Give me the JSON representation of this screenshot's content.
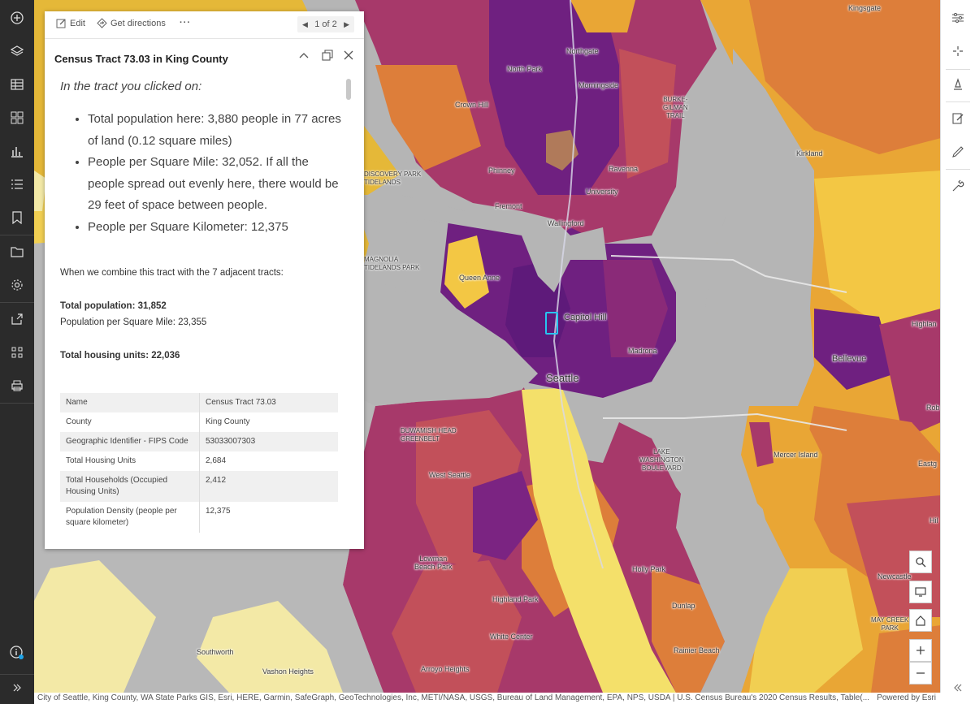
{
  "left_toolbar": {
    "items": [
      "add-icon",
      "layers-icon",
      "table-icon",
      "legend-icon",
      "charts-icon",
      "properties-icon",
      "bookmark-icon",
      "folder-icon",
      "settings-icon",
      "share-icon",
      "apps-icon",
      "print-icon"
    ],
    "bottom": [
      "info-icon",
      "expand-icon"
    ]
  },
  "right_toolbar": {
    "items": [
      "filter-icon",
      "effects-icon",
      "styles-icon",
      "edit-icon",
      "sketch-icon",
      "config-icon"
    ],
    "collapse": "collapse-icon"
  },
  "popup": {
    "edit_label": "Edit",
    "directions_label": "Get directions",
    "more_label": "···",
    "pager_label": "1 of 2",
    "title": "Census Tract 73.03 in King County",
    "intro": "In the tract you clicked on:",
    "bullets": [
      "Total population here: 3,880 people in 77 acres of land (0.12 square miles)",
      "People per Square Mile: 32,052. If all the people spread out evenly here, there would be 29 feet of space between people.",
      "People per Square Kilometer: 12,375"
    ],
    "combine_text": "When we combine this tract with the 7 adjacent tracts:",
    "total_population_label": "Total population: 31,852",
    "pop_per_sqmi": "Population per Square Mile: 23,355",
    "total_housing_label": "Total housing units: 22,036",
    "fields": [
      {
        "k": "Name",
        "v": "Census Tract 73.03"
      },
      {
        "k": "County",
        "v": "King County"
      },
      {
        "k": "Geographic Identifier - FIPS Code",
        "v": "53033007303"
      },
      {
        "k": "Total Housing Units",
        "v": "2,684"
      },
      {
        "k": "Total Households (Occupied Housing Units)",
        "v": "2,412"
      },
      {
        "k": "Population Density (people per square kilometer)",
        "v": "12,375"
      }
    ]
  },
  "map": {
    "labels": {
      "kingsgate": "Kingsgate",
      "northgate": "Northgate",
      "north_park": "North Park",
      "morningside": "Morningside",
      "burke_gilman": "BURKE-\nGILMAN\nTRAIL",
      "crown_hill": "Crown Hill",
      "kirkland": "Kirkland",
      "discovery": "DISCOVERY PARK\nTIDELANDS",
      "phinney": "Phinney",
      "ravenna": "Ravenna",
      "university": "University",
      "fremont": "Fremont",
      "wallingford": "Wallingford",
      "magnolia": "MAGNOLIA\nTIDELANDS PARK",
      "queen_anne": "Queen Anne",
      "capitol_hill": "Capitol Hill",
      "highlan": "Highlan",
      "madrona": "Madrona",
      "bellevue": "Bellevue",
      "seattle": "Seattle",
      "rob": "Rob",
      "duwamish": "DUWAMISH HEAD\nGREENBELT",
      "lake_wa_blvd": "LAKE\nWASHINGTON\nBOULEVARD",
      "mercer_island": "Mercer Island",
      "eastg": "Eastg",
      "west_seattle": "West Seattle",
      "hil": "Hil",
      "lowman": "Lowman\nBeach Park",
      "holly_park": "Holly Park",
      "newcastle": "Newcastle",
      "highland_park": "Highland Park",
      "dunlap": "Dunlap",
      "may_creek": "MAY CREEK\nPARK",
      "white_center": "White Center",
      "southworth": "Southworth",
      "rainier_beach": "Rainier Beach",
      "vashon_heights": "Vashon Heights",
      "arroyo_heights": "Arroyo Heights"
    },
    "controls": [
      "search-icon",
      "monitor-icon",
      "home-icon",
      "zoom-in-icon",
      "zoom-out-icon"
    ]
  },
  "attribution": {
    "text": "City of Seattle, King County, WA State Parks GIS, Esri, HERE, Garmin, SafeGraph, GeoTechnologies, Inc, METI/NASA, USGS, Bureau of Land Management, EPA, NPS, USDA | U.S. Census Bureau's 2020 Census Results, Table(...",
    "powered": "Powered by Esri"
  },
  "colors": {
    "purple_dark": "#5e1a7a",
    "purple": "#7b2482",
    "magenta": "#a2356c",
    "rose": "#c2505a",
    "orange": "#dd7e3a",
    "amber": "#e9a635",
    "yellow": "#f3c744",
    "light_yellow": "#f6e78a",
    "water": "#b3b3b3",
    "selected_outline": "#27c4f0"
  }
}
